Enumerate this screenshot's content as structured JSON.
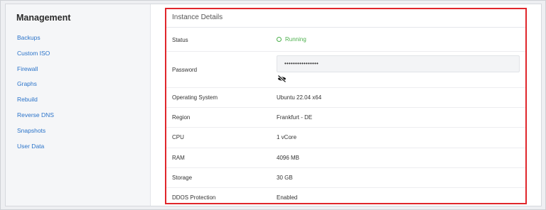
{
  "sidebar": {
    "title": "Management",
    "items": [
      {
        "label": "Backups"
      },
      {
        "label": "Custom ISO"
      },
      {
        "label": "Firewall"
      },
      {
        "label": "Graphs"
      },
      {
        "label": "Rebuild"
      },
      {
        "label": "Reverse DNS"
      },
      {
        "label": "Snapshots"
      },
      {
        "label": "User Data"
      }
    ]
  },
  "details": {
    "title": "Instance Details",
    "status": {
      "label": "Status",
      "value": "Running",
      "icon": "status-circle-icon",
      "color": "#4cb04c"
    },
    "password": {
      "label": "Password",
      "masked_value": "••••••••••••••••",
      "toggle_icon": "eye-slash-icon"
    },
    "os": {
      "label": "Operating System",
      "value": "Ubuntu 22.04 x64"
    },
    "region": {
      "label": "Region",
      "value": "Frankfurt - DE"
    },
    "cpu": {
      "label": "CPU",
      "value": "1 vCore"
    },
    "ram": {
      "label": "RAM",
      "value": "4096 MB"
    },
    "storage": {
      "label": "Storage",
      "value": "30 GB"
    },
    "ddos": {
      "label": "DDOS Protection",
      "value": "Enabled"
    }
  },
  "colors": {
    "link": "#2a73c9",
    "highlight_border": "#e0262b",
    "status_green": "#4cb04c"
  }
}
